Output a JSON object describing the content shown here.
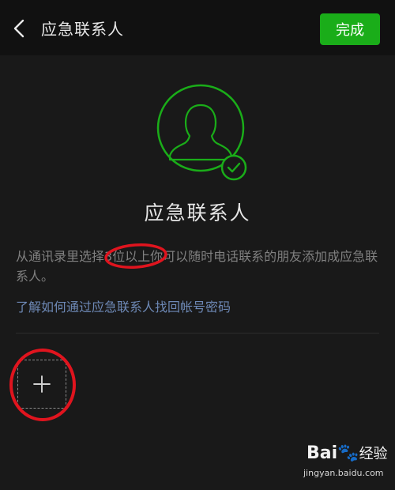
{
  "header": {
    "title": "应急联系人",
    "done_label": "完成"
  },
  "main": {
    "heading": "应急联系人",
    "description": "从通讯录里选择3位以上你可以随时电话联系的朋友添加成应急联系人。",
    "help_link": "了解如何通过应急联系人找回帐号密码"
  },
  "icons": {
    "back": "back-chevron-icon",
    "avatar": "contact-avatar-icon",
    "check": "check-badge-icon",
    "add": "plus-icon"
  },
  "colors": {
    "accent_green": "#1aad19",
    "link_blue": "#6d88b5",
    "annotation_red": "#e0141e",
    "background": "#191919"
  },
  "watermark": {
    "brand": "Bai",
    "brand_suffix": "经验",
    "url": "jingyan.baidu.com"
  }
}
